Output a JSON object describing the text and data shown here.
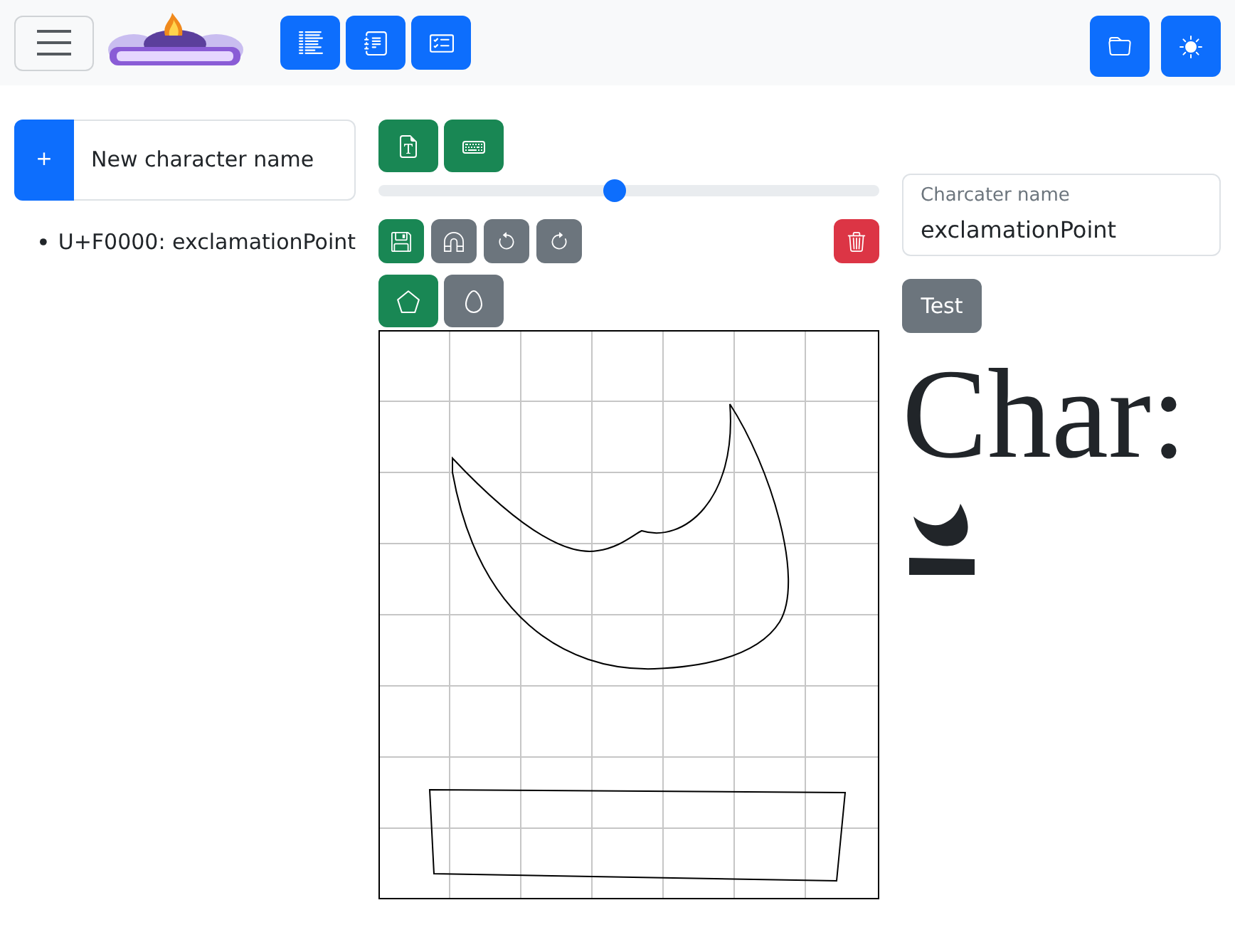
{
  "toolbar": {
    "menu_button": {
      "kind": "menu"
    },
    "view_buttons": [
      {
        "kind": "list"
      },
      {
        "kind": "journal"
      },
      {
        "kind": "checklist"
      }
    ],
    "action_buttons": [
      {
        "kind": "folder"
      },
      {
        "kind": "theme"
      }
    ]
  },
  "sidebar": {
    "new_character": {
      "button": "+",
      "value": "New character name"
    },
    "characters": [
      {
        "label": "U+F0000: exclamationPoint"
      }
    ]
  },
  "editor": {
    "mode_buttons": [
      {
        "kind": "font_file"
      },
      {
        "kind": "keyboard"
      }
    ],
    "zoom_slider": {
      "level": 0.47
    },
    "actions": [
      {
        "kind": "save"
      },
      {
        "kind": "magnet",
        "on": false
      },
      {
        "kind": "undo"
      },
      {
        "kind": "redo"
      },
      {
        "kind": "delete"
      }
    ],
    "tools": [
      {
        "kind": "polygon",
        "selected": true
      },
      {
        "kind": "ellipse",
        "selected": false
      }
    ]
  },
  "preview": {
    "name_field": {
      "label": "Charcater name",
      "value": "exclamationPoint"
    },
    "test_button": "Test",
    "heading": "Char:"
  }
}
